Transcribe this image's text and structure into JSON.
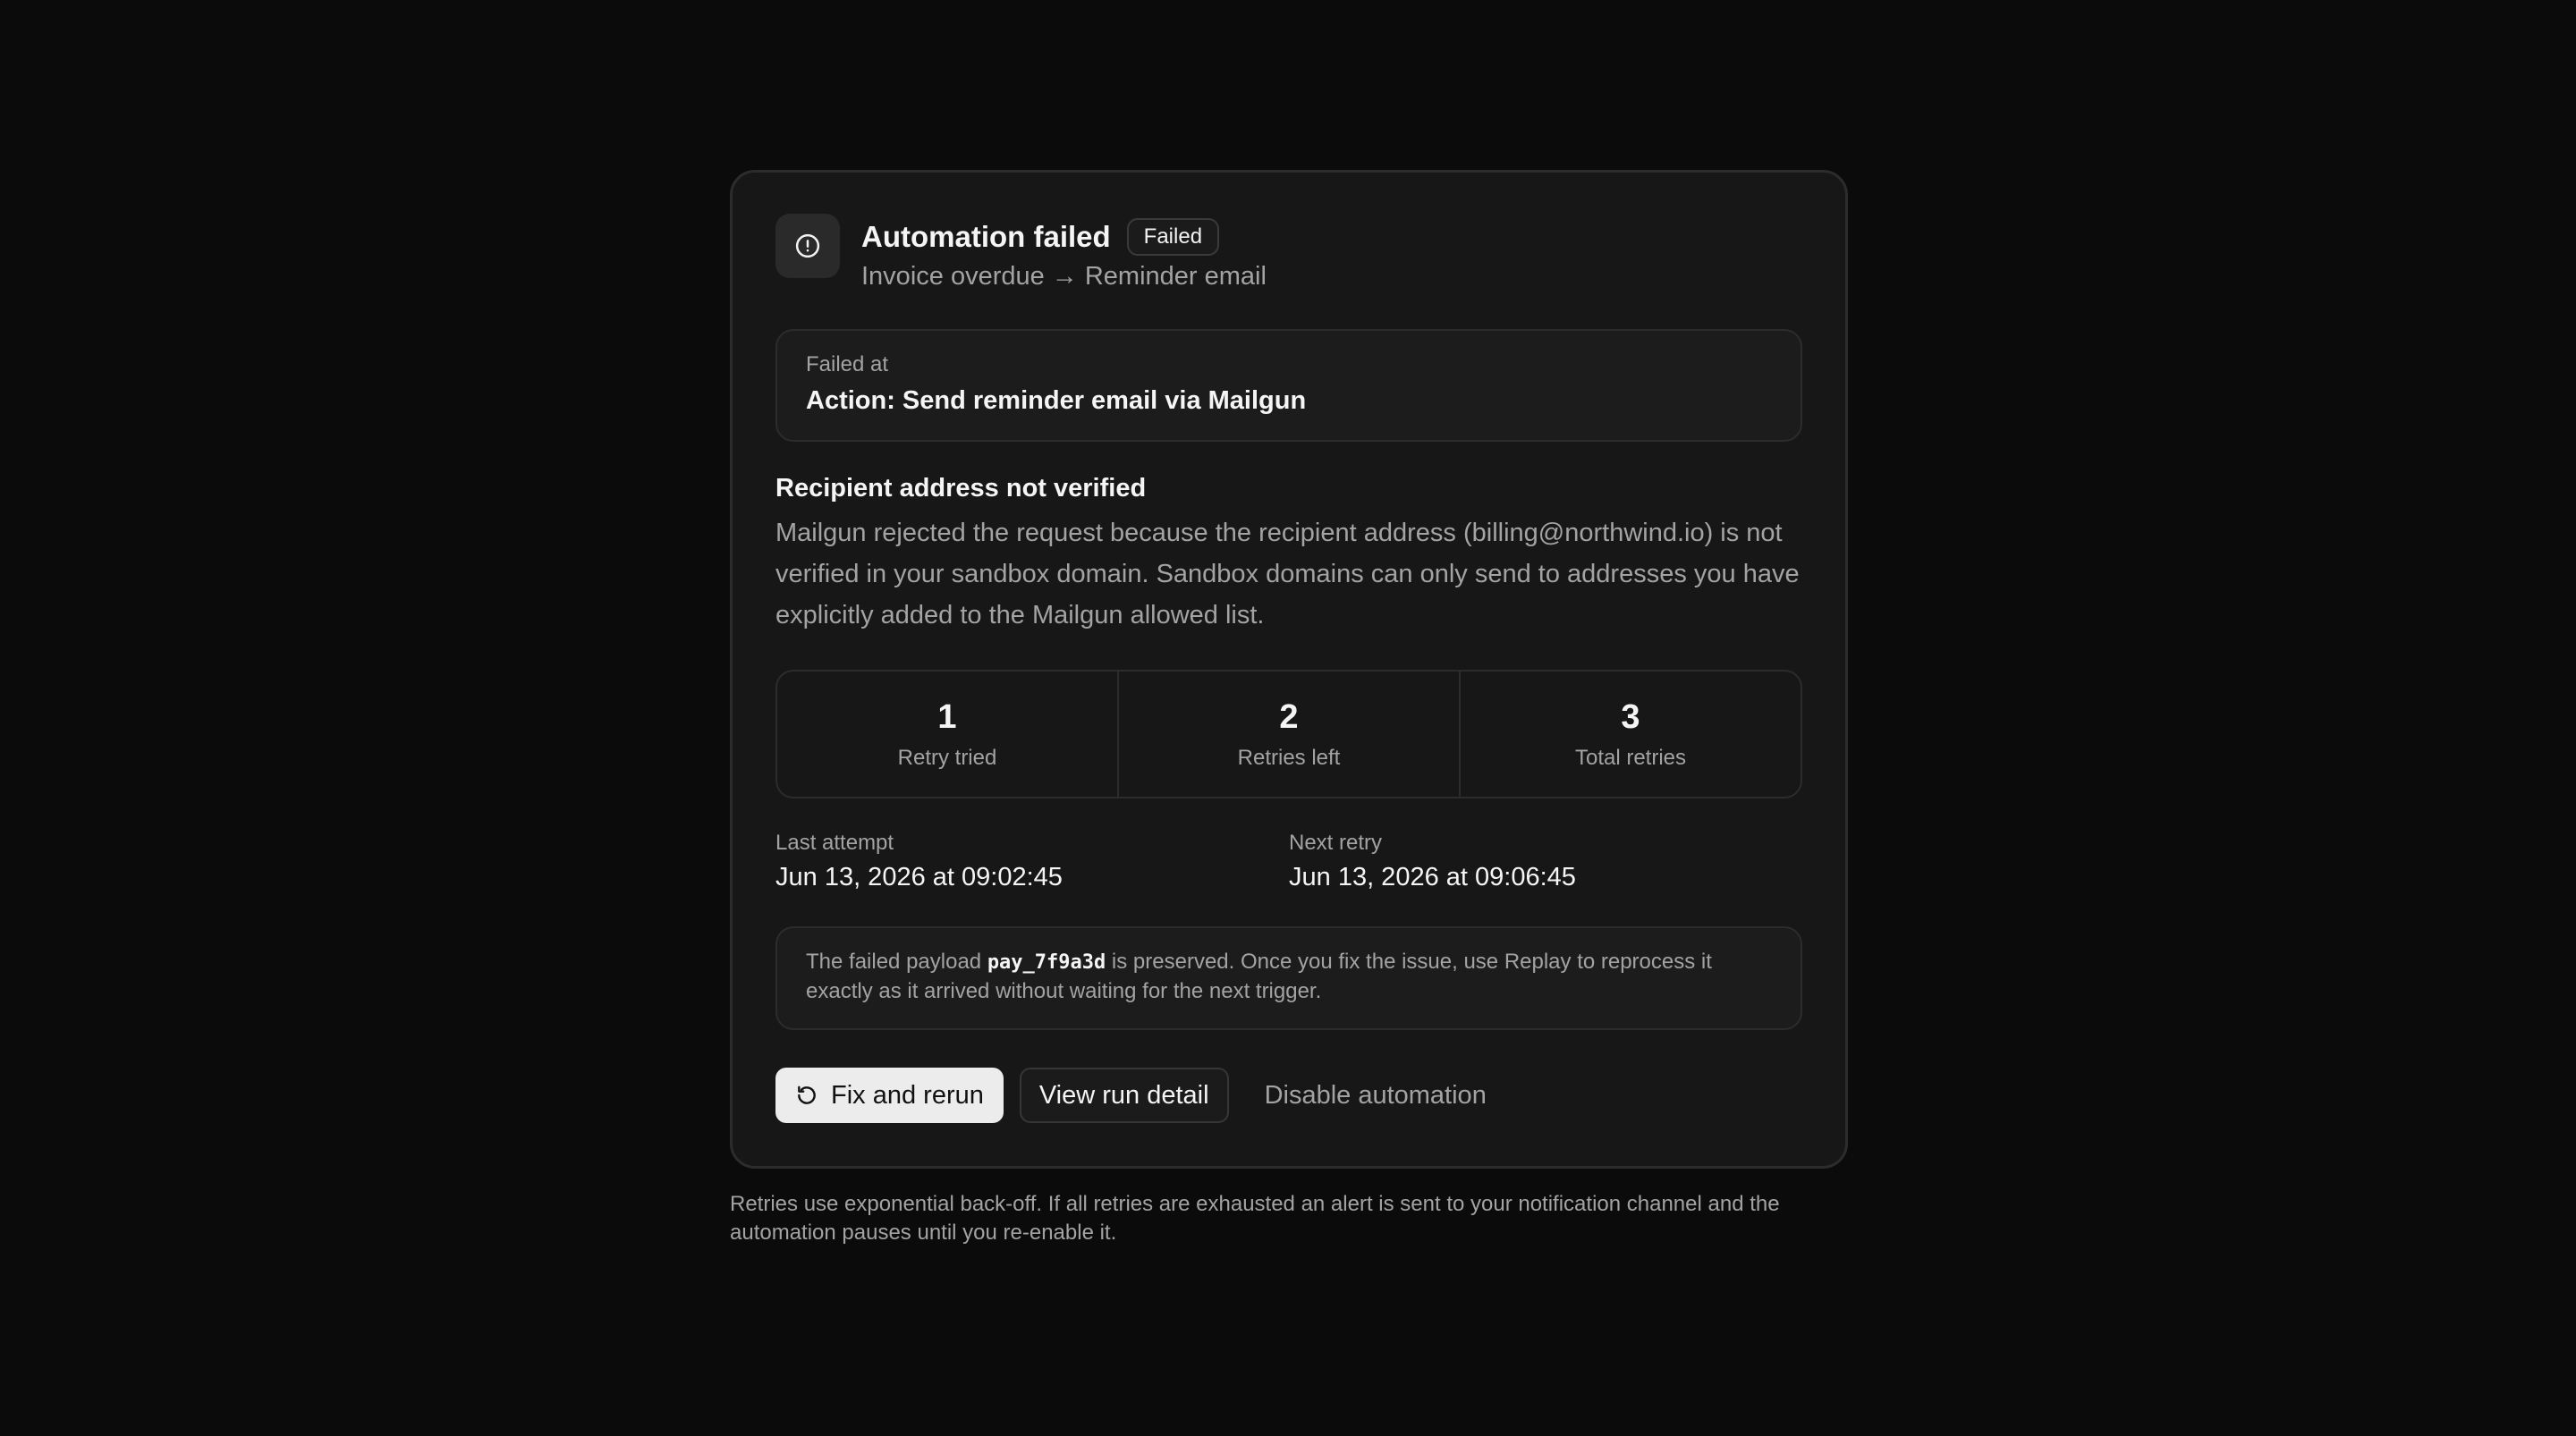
{
  "card": {
    "title": "Automation failed",
    "status_badge": "Failed",
    "subtitle": "Invoice overdue → Reminder email",
    "alert_icon": "alert-circle-icon"
  },
  "failed_at": {
    "label": "Failed at",
    "value": "Action: Send reminder email via Mailgun"
  },
  "error": {
    "title": "Recipient address not verified",
    "description": "Mailgun rejected the request because the recipient address (billing@northwind.io) is not verified in your sandbox domain. Sandbox domains can only send to addresses you have explicitly added to the Mailgun allowed list."
  },
  "stats": [
    {
      "value": "1",
      "label": "Retry tried"
    },
    {
      "value": "2",
      "label": "Retries left"
    },
    {
      "value": "3",
      "label": "Total retries"
    }
  ],
  "attempts": {
    "last_label": "Last attempt",
    "last_value": "Jun 13, 2026 at 09:02:45",
    "next_label": "Next retry",
    "next_value": "Jun 13, 2026 at 09:06:45"
  },
  "payload": {
    "prefix": "The failed payload ",
    "code": "pay_7f9a3d",
    "suffix": " is preserved. Once you fix the issue, use Replay to reprocess it exactly as it arrived without waiting for the next trigger."
  },
  "actions": {
    "primary_label": "Fix and rerun",
    "primary_icon": "rerun-icon",
    "secondary_label": "View run detail",
    "ghost_label": "Disable automation"
  },
  "footnote": "Retries use exponential back-off. If all retries are exhausted an alert is sent to your notification channel and the automation pauses until you re-enable it.",
  "colors": {
    "background": "#0b0b0b",
    "card": "#171717",
    "border": "#2c2c2c",
    "text_primary": "#f5f5f5",
    "text_muted": "#a3a3a3",
    "primary_button": "#ececec"
  }
}
